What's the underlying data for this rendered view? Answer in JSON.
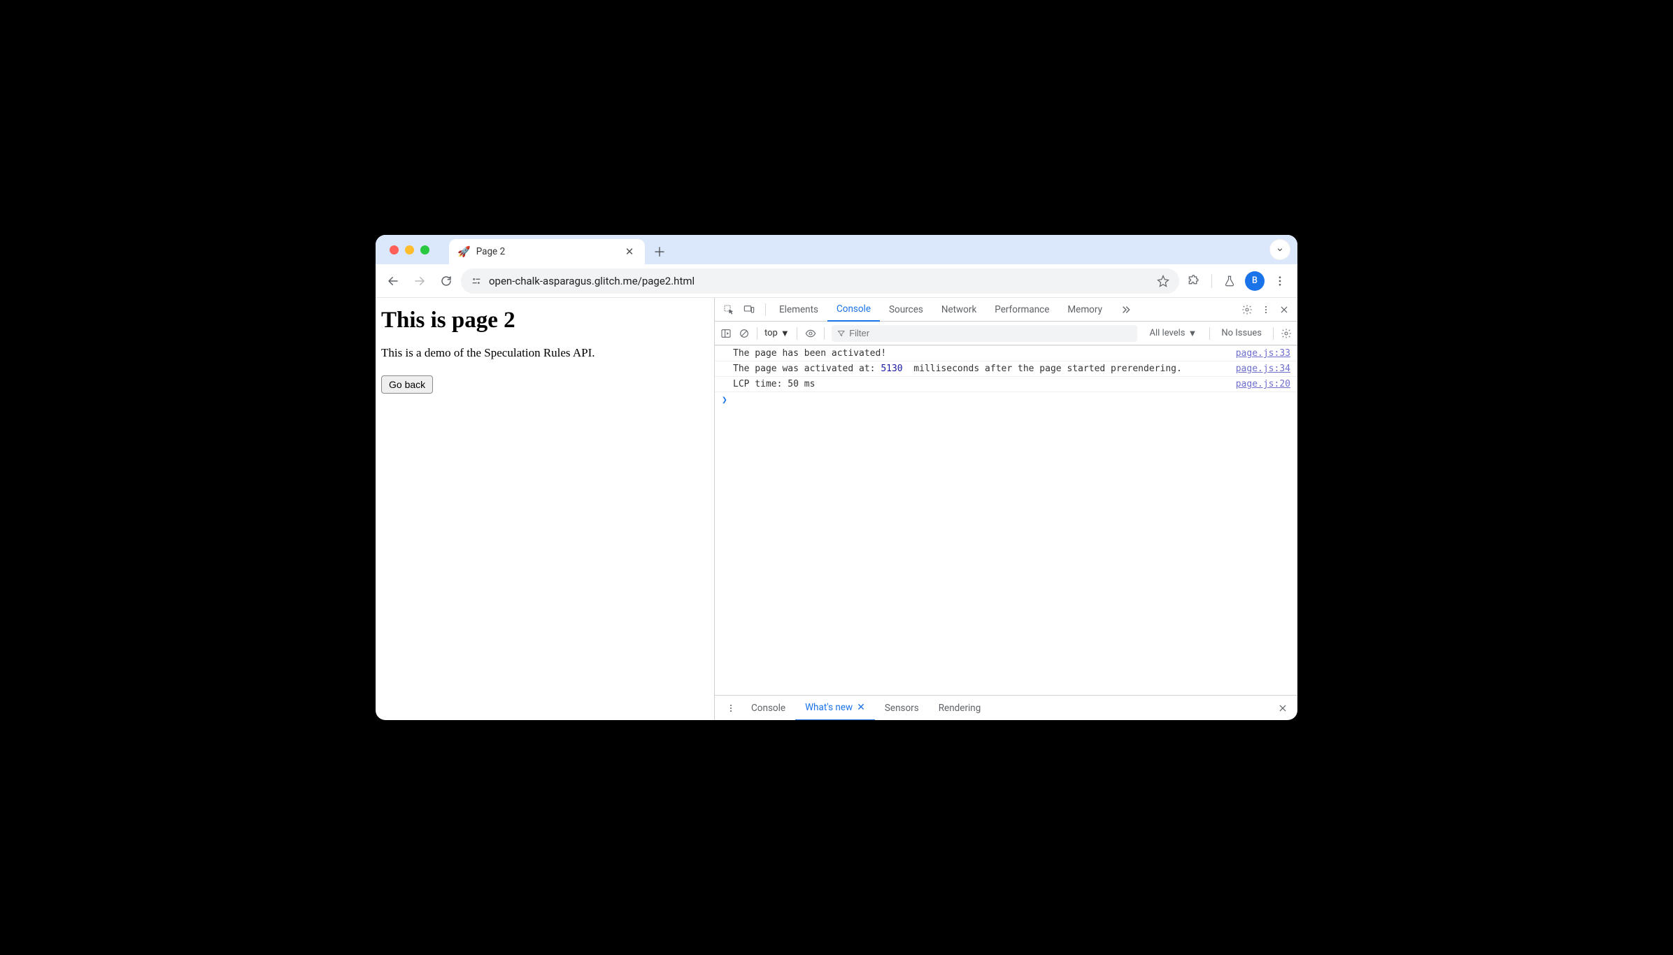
{
  "chrome": {
    "tab_title": "Page 2",
    "favicon": "🚀",
    "url": "open-chalk-asparagus.glitch.me/page2.html",
    "avatar_letter": "B",
    "tabstrip_dropdown": "⌄"
  },
  "page": {
    "heading": "This is page 2",
    "body": "This is a demo of the Speculation Rules API.",
    "button": "Go back"
  },
  "devtools": {
    "tabs": {
      "elements": "Elements",
      "console": "Console",
      "sources": "Sources",
      "network": "Network",
      "performance": "Performance",
      "memory": "Memory"
    },
    "console_toolbar": {
      "context": "top",
      "filter_placeholder": "Filter",
      "levels": "All levels",
      "issues": "No Issues"
    },
    "messages": {
      "m1_text": "The page has been activated!",
      "m1_src": "page.js:33",
      "m2_pre": "The page was activated at: ",
      "m2_num": "5130",
      "m2_post": "  milliseconds after the page started prerendering.",
      "m2_src": "page.js:34",
      "m3_text": "LCP time: 50 ms",
      "m3_src": "page.js:20"
    },
    "drawer": {
      "console": "Console",
      "whatsnew": "What's new",
      "sensors": "Sensors",
      "rendering": "Rendering"
    }
  }
}
